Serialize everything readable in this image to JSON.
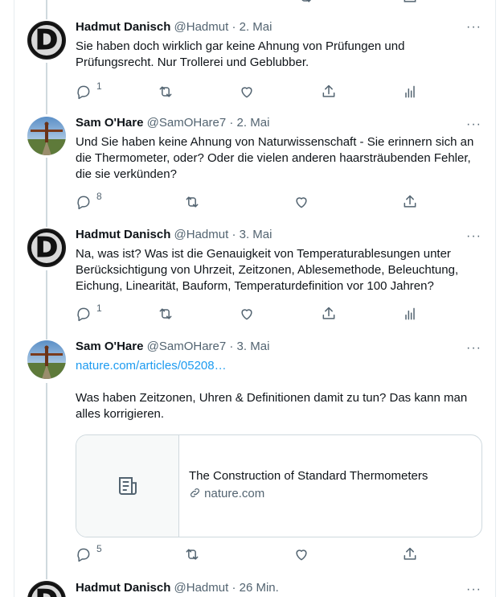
{
  "tweets": [
    {
      "author": "Hadmut Danisch",
      "handle": "@Hadmut",
      "date": "· 2. Mai",
      "avatar_letter": "D",
      "lines": [
        "Sie haben doch wirklich gar keine Ahnung von Prüfungen und",
        "Prüfungsrecht. Nur Trollerei und Geblubber."
      ],
      "reply_count": "1"
    },
    {
      "author": "Sam O'Hare",
      "handle": "@SamOHare7",
      "date": "· 2. Mai",
      "lines": [
        "Und Sie haben keine Ahnung von Naturwissenschaft - Sie erinnern sich an",
        "die Thermometer, oder? Oder die vielen anderen haarsträubenden Fehler,",
        "die sie verkünden?"
      ],
      "reply_count": "8"
    },
    {
      "author": "Hadmut Danisch",
      "handle": "@Hadmut",
      "date": "· 3. Mai",
      "avatar_letter": "D",
      "lines": [
        "Na, was ist? Was ist die Genauigkeit von Temperaturablesungen unter",
        "Berücksichtigung von Uhrzeit, Zeitzonen, Ablesemethode, Beleuchtung,",
        "Eichung, Linearität, Bauform, Temperaturdefinition vor 100 Jahren?"
      ],
      "reply_count": "1"
    },
    {
      "author": "Sam O'Hare",
      "handle": "@SamOHare7",
      "date": "· 3. Mai",
      "link_text": "nature.com/articles/05208…",
      "lines": [
        "Was haben Zeitzonen, Uhren & Definitionen damit zu tun? Das kann man",
        "alles korrigieren."
      ],
      "card": {
        "title": "The Construction of Standard Thermometers",
        "domain": "nature.com"
      },
      "reply_count": "5"
    },
    {
      "author": "Hadmut Danisch",
      "handle": "@Hadmut",
      "date": "· 26 Min.",
      "avatar_letter": "D"
    }
  ],
  "more_glyph": "···"
}
